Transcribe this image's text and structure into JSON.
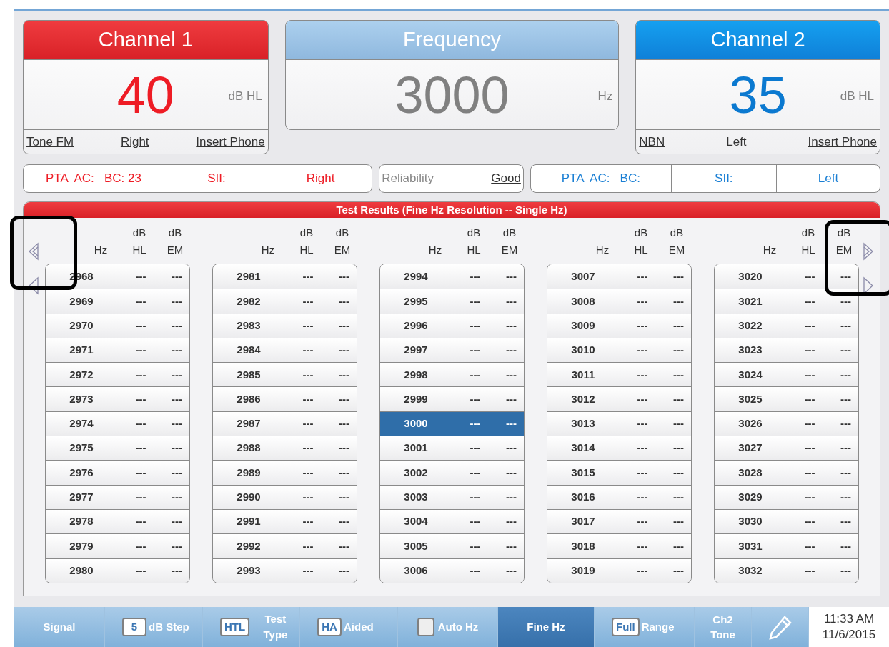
{
  "channels": [
    {
      "title": "Channel 1",
      "value": "40",
      "unit": "dB HL",
      "color": "#ee1c25",
      "footer": [
        {
          "text": "Tone FM",
          "link": true
        },
        {
          "text": "Right",
          "link": true
        },
        {
          "text": "Insert Phone",
          "link": true
        }
      ]
    },
    {
      "title": "Frequency",
      "value": "3000",
      "unit": "Hz",
      "color": "#808080"
    },
    {
      "title": "Channel 2",
      "value": "35",
      "unit": "dB HL",
      "color": "#0b79d0",
      "footer": [
        {
          "text": "NBN",
          "link": true
        },
        {
          "text": "Left",
          "link": false
        },
        {
          "text": "Insert Phone",
          "link": true
        }
      ]
    }
  ],
  "summary_left": {
    "color": "#ee1c25",
    "cells": [
      "PTA  AC:   BC: 23",
      "SII:",
      "Right"
    ]
  },
  "reliability": {
    "label": "Reliability",
    "value": "Good"
  },
  "summary_right": {
    "color": "#1a7fd4",
    "cells": [
      "PTA  AC:   BC:",
      "SII:",
      "Left"
    ]
  },
  "results": {
    "title": "Test Results (Fine Hz Resolution -- Single Hz)",
    "groups": [
      {
        "headers": [
          "Hz",
          "dB HL",
          "dB EM"
        ],
        "rows": [
          {
            "hz": "2968",
            "hl": "---",
            "em": "---",
            "selected": false
          },
          {
            "hz": "2969",
            "hl": "---",
            "em": "---",
            "selected": false
          },
          {
            "hz": "2970",
            "hl": "---",
            "em": "---",
            "selected": false
          },
          {
            "hz": "2971",
            "hl": "---",
            "em": "---",
            "selected": false
          },
          {
            "hz": "2972",
            "hl": "---",
            "em": "---",
            "selected": false
          },
          {
            "hz": "2973",
            "hl": "---",
            "em": "---",
            "selected": false
          },
          {
            "hz": "2974",
            "hl": "---",
            "em": "---",
            "selected": false
          },
          {
            "hz": "2975",
            "hl": "---",
            "em": "---",
            "selected": false
          },
          {
            "hz": "2976",
            "hl": "---",
            "em": "---",
            "selected": false
          },
          {
            "hz": "2977",
            "hl": "---",
            "em": "---",
            "selected": false
          },
          {
            "hz": "2978",
            "hl": "---",
            "em": "---",
            "selected": false
          },
          {
            "hz": "2979",
            "hl": "---",
            "em": "---",
            "selected": false
          },
          {
            "hz": "2980",
            "hl": "---",
            "em": "---",
            "selected": false
          }
        ]
      },
      {
        "headers": [
          "Hz",
          "dB HL",
          "dB EM"
        ],
        "rows": [
          {
            "hz": "2981",
            "hl": "---",
            "em": "---",
            "selected": false
          },
          {
            "hz": "2982",
            "hl": "---",
            "em": "---",
            "selected": false
          },
          {
            "hz": "2983",
            "hl": "---",
            "em": "---",
            "selected": false
          },
          {
            "hz": "2984",
            "hl": "---",
            "em": "---",
            "selected": false
          },
          {
            "hz": "2985",
            "hl": "---",
            "em": "---",
            "selected": false
          },
          {
            "hz": "2986",
            "hl": "---",
            "em": "---",
            "selected": false
          },
          {
            "hz": "2987",
            "hl": "---",
            "em": "---",
            "selected": false
          },
          {
            "hz": "2988",
            "hl": "---",
            "em": "---",
            "selected": false
          },
          {
            "hz": "2989",
            "hl": "---",
            "em": "---",
            "selected": false
          },
          {
            "hz": "2990",
            "hl": "---",
            "em": "---",
            "selected": false
          },
          {
            "hz": "2991",
            "hl": "---",
            "em": "---",
            "selected": false
          },
          {
            "hz": "2992",
            "hl": "---",
            "em": "---",
            "selected": false
          },
          {
            "hz": "2993",
            "hl": "---",
            "em": "---",
            "selected": false
          }
        ]
      },
      {
        "headers": [
          "Hz",
          "dB HL",
          "dB EM"
        ],
        "rows": [
          {
            "hz": "2994",
            "hl": "---",
            "em": "---",
            "selected": false
          },
          {
            "hz": "2995",
            "hl": "---",
            "em": "---",
            "selected": false
          },
          {
            "hz": "2996",
            "hl": "---",
            "em": "---",
            "selected": false
          },
          {
            "hz": "2997",
            "hl": "---",
            "em": "---",
            "selected": false
          },
          {
            "hz": "2998",
            "hl": "---",
            "em": "---",
            "selected": false
          },
          {
            "hz": "2999",
            "hl": "---",
            "em": "---",
            "selected": false
          },
          {
            "hz": "3000",
            "hl": "---",
            "em": "---",
            "selected": true
          },
          {
            "hz": "3001",
            "hl": "---",
            "em": "---",
            "selected": false
          },
          {
            "hz": "3002",
            "hl": "---",
            "em": "---",
            "selected": false
          },
          {
            "hz": "3003",
            "hl": "---",
            "em": "---",
            "selected": false
          },
          {
            "hz": "3004",
            "hl": "---",
            "em": "---",
            "selected": false
          },
          {
            "hz": "3005",
            "hl": "---",
            "em": "---",
            "selected": false
          },
          {
            "hz": "3006",
            "hl": "---",
            "em": "---",
            "selected": false
          }
        ]
      },
      {
        "headers": [
          "Hz",
          "dB HL",
          "dB EM"
        ],
        "rows": [
          {
            "hz": "3007",
            "hl": "---",
            "em": "---",
            "selected": false
          },
          {
            "hz": "3008",
            "hl": "---",
            "em": "---",
            "selected": false
          },
          {
            "hz": "3009",
            "hl": "---",
            "em": "---",
            "selected": false
          },
          {
            "hz": "3010",
            "hl": "---",
            "em": "---",
            "selected": false
          },
          {
            "hz": "3011",
            "hl": "---",
            "em": "---",
            "selected": false
          },
          {
            "hz": "3012",
            "hl": "---",
            "em": "---",
            "selected": false
          },
          {
            "hz": "3013",
            "hl": "---",
            "em": "---",
            "selected": false
          },
          {
            "hz": "3014",
            "hl": "---",
            "em": "---",
            "selected": false
          },
          {
            "hz": "3015",
            "hl": "---",
            "em": "---",
            "selected": false
          },
          {
            "hz": "3016",
            "hl": "---",
            "em": "---",
            "selected": false
          },
          {
            "hz": "3017",
            "hl": "---",
            "em": "---",
            "selected": false
          },
          {
            "hz": "3018",
            "hl": "---",
            "em": "---",
            "selected": false
          },
          {
            "hz": "3019",
            "hl": "---",
            "em": "---",
            "selected": false
          }
        ]
      },
      {
        "headers": [
          "Hz",
          "dB HL",
          "dB EM"
        ],
        "rows": [
          {
            "hz": "3020",
            "hl": "---",
            "em": "---",
            "selected": false
          },
          {
            "hz": "3021",
            "hl": "---",
            "em": "---",
            "selected": false
          },
          {
            "hz": "3022",
            "hl": "---",
            "em": "---",
            "selected": false
          },
          {
            "hz": "3023",
            "hl": "---",
            "em": "---",
            "selected": false
          },
          {
            "hz": "3024",
            "hl": "---",
            "em": "---",
            "selected": false
          },
          {
            "hz": "3025",
            "hl": "---",
            "em": "---",
            "selected": false
          },
          {
            "hz": "3026",
            "hl": "---",
            "em": "---",
            "selected": false
          },
          {
            "hz": "3027",
            "hl": "---",
            "em": "---",
            "selected": false
          },
          {
            "hz": "3028",
            "hl": "---",
            "em": "---",
            "selected": false
          },
          {
            "hz": "3029",
            "hl": "---",
            "em": "---",
            "selected": false
          },
          {
            "hz": "3030",
            "hl": "---",
            "em": "---",
            "selected": false
          },
          {
            "hz": "3031",
            "hl": "---",
            "em": "---",
            "selected": false
          },
          {
            "hz": "3032",
            "hl": "---",
            "em": "---",
            "selected": false
          }
        ]
      }
    ]
  },
  "toolbar": [
    {
      "kind": "button",
      "label": "Signal",
      "selected": false
    },
    {
      "kind": "value",
      "value": "5",
      "label": "dB Step",
      "selected": false
    },
    {
      "kind": "value",
      "value": "HTL",
      "label": "Test Type",
      "selected": false
    },
    {
      "kind": "value",
      "value": "HA",
      "label": "Aided",
      "selected": false
    },
    {
      "kind": "check",
      "checked": false,
      "label": "Auto Hz",
      "selected": false
    },
    {
      "kind": "button",
      "label": "Fine Hz",
      "selected": true
    },
    {
      "kind": "value",
      "value": "Full",
      "label": "Range",
      "selected": false
    },
    {
      "kind": "stack",
      "label": "Ch2 Tone",
      "selected": false
    },
    {
      "kind": "pencil",
      "selected": false
    }
  ],
  "clock": {
    "time": "11:33 AM",
    "date": "11/6/2015"
  }
}
